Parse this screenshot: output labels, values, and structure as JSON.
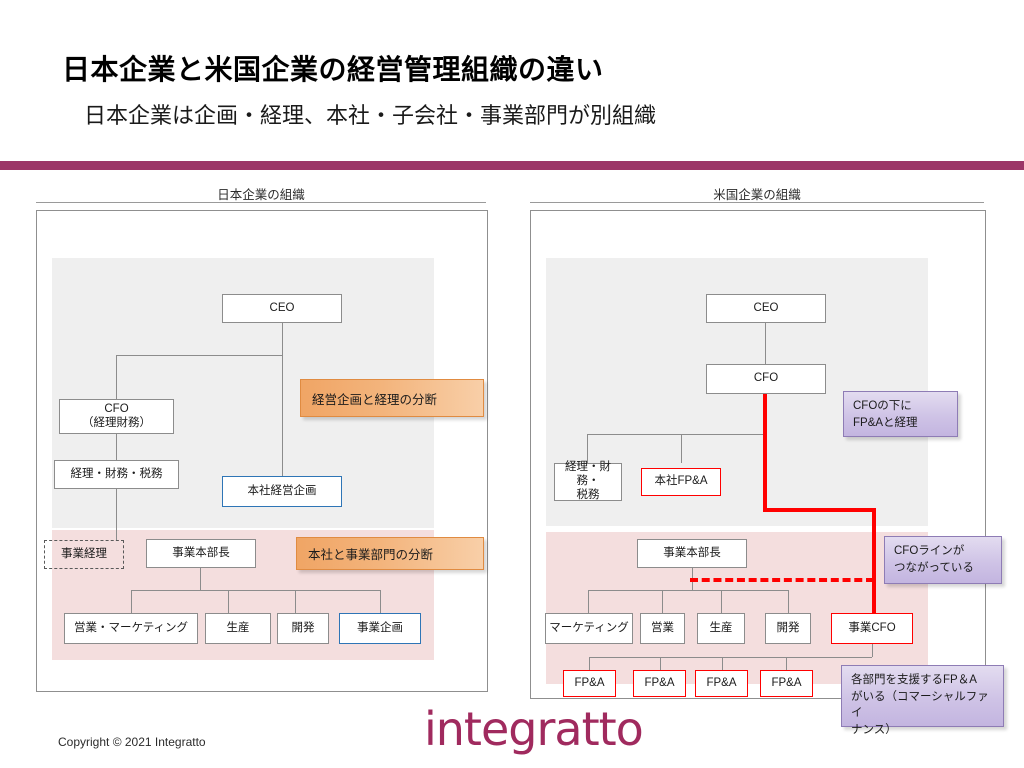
{
  "slide": {
    "title": "日本企業と米国企業の経営管理組織の違い",
    "subtitle": "日本企業は企画・経理、本社・子会社・事業部門が別組織",
    "accent_color": "#9c3567",
    "highlight_color": "#ff0000",
    "callout_orange_color": "#f0a565",
    "callout_purple_color": "#cfc3e6"
  },
  "left_panel": {
    "header": "日本企業の組織",
    "nodes": {
      "ceo": "CEO",
      "cfo": "CFO\n（経理財務）",
      "cfo_line1": "CFO",
      "cfo_line2": "（経理財務）",
      "accounting": "経理・財務・税務",
      "hq_planning": "本社経営企画",
      "div_accounting": "事業経理",
      "div_head": "事業本部長",
      "sales_marketing": "営業・マーケティング",
      "production": "生産",
      "development": "開発",
      "business_planning": "事業企画"
    },
    "callouts": [
      "経営企画と経理の分断",
      "本社と事業部門の分断"
    ]
  },
  "right_panel": {
    "header": "米国企業の組織",
    "nodes": {
      "ceo": "CEO",
      "cfo": "CFO",
      "accounting_line1": "経理・財務・",
      "accounting_line2": "税務",
      "hq_fpa": "本社FP&A",
      "div_head": "事業本部長",
      "marketing": "マーケティング",
      "sales": "営業",
      "production": "生産",
      "development": "開発",
      "div_cfo": "事業CFO",
      "fpa": "FP&A"
    },
    "fpa_row": [
      "FP&A",
      "FP&A",
      "FP&A",
      "FP&A"
    ],
    "callouts": [
      {
        "line1": "CFOの下に",
        "line2": "FP&Aと経理"
      },
      {
        "line1": "CFOラインが",
        "line2": "つながっている"
      },
      {
        "line1": "各部門を支援するFP＆A",
        "line2": "がいる（コマーシャルファイ",
        "line3": "ナンス）"
      }
    ]
  },
  "footer": {
    "copyright": "Copyright © 2021 Integratto",
    "logo": "integratto"
  }
}
